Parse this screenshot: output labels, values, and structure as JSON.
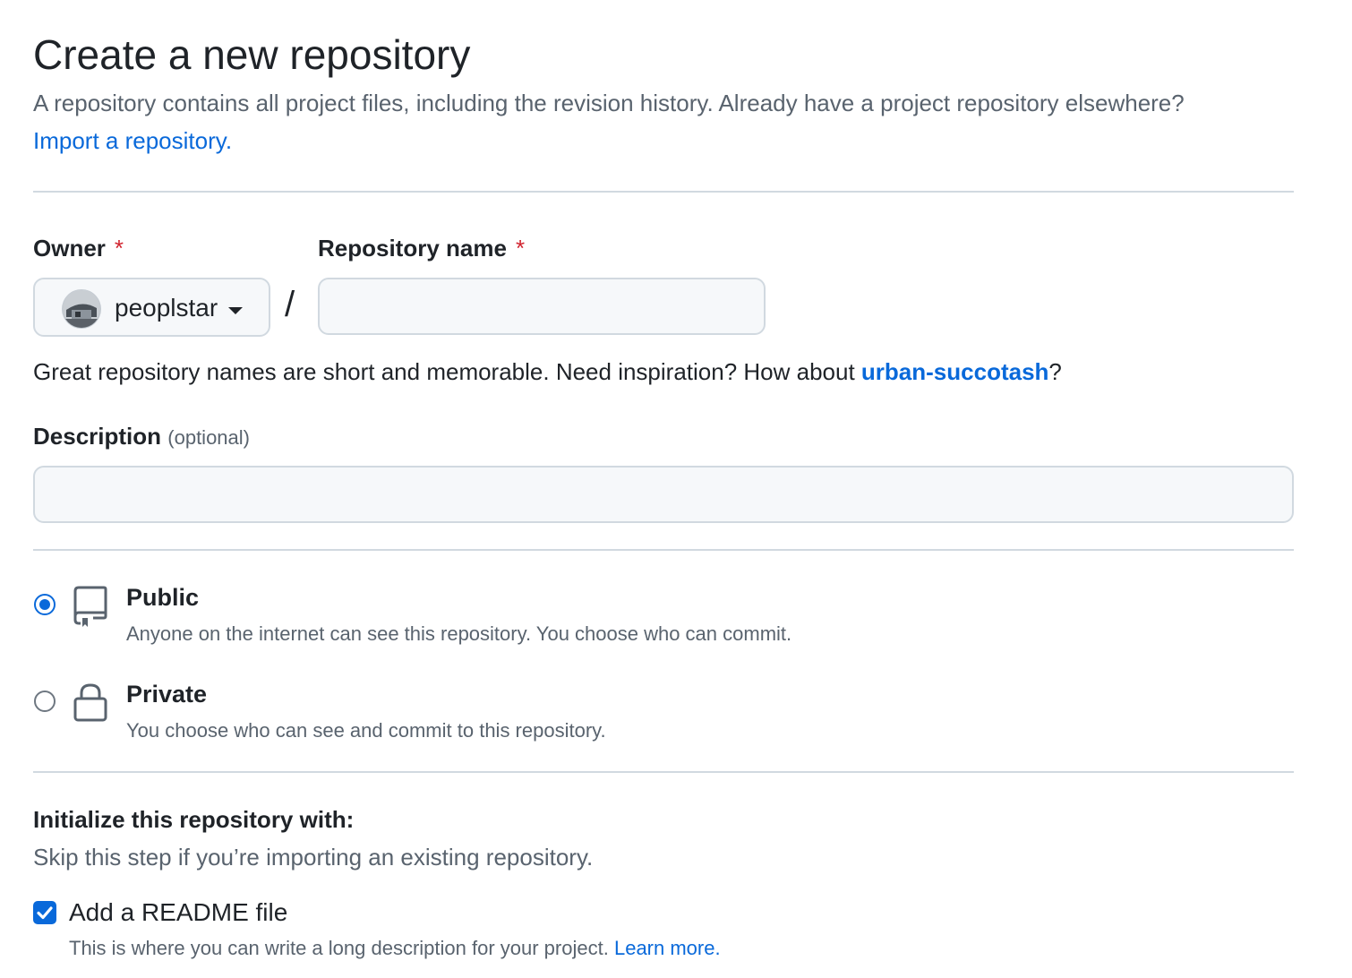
{
  "header": {
    "title": "Create a new repository",
    "subtitle": "A repository contains all project files, including the revision history. Already have a project repository elsewhere?",
    "import_link": "Import a repository."
  },
  "owner": {
    "label": "Owner",
    "required_mark": "*",
    "selected": "peoplstar"
  },
  "separator": "/",
  "repo_name": {
    "label": "Repository name",
    "required_mark": "*",
    "value": "",
    "placeholder": ""
  },
  "name_hint": {
    "text": "Great repository names are short and memorable. Need inspiration? How about ",
    "suggestion": "urban-succotash",
    "suffix": "?"
  },
  "description": {
    "label": "Description",
    "optional": "(optional)",
    "value": "",
    "placeholder": ""
  },
  "visibility": {
    "selected": "public",
    "options": [
      {
        "id": "public",
        "label": "Public",
        "description": "Anyone on the internet can see this repository. You choose who can commit.",
        "icon": "repo-icon",
        "checked": true
      },
      {
        "id": "private",
        "label": "Private",
        "description": "You choose who can see and commit to this repository.",
        "icon": "lock-icon",
        "checked": false
      }
    ]
  },
  "initialize": {
    "title": "Initialize this repository with:",
    "subtitle": "Skip this step if you’re importing an existing repository.",
    "readme": {
      "label": "Add a README file",
      "checked": true,
      "description": "This is where you can write a long description for your project.",
      "learn_more": "Learn more."
    }
  },
  "colors": {
    "accent": "#0969da",
    "required": "#d1242f",
    "muted_text": "#59636e",
    "border": "#d1d9e0",
    "input_bg": "#f6f8fa"
  }
}
